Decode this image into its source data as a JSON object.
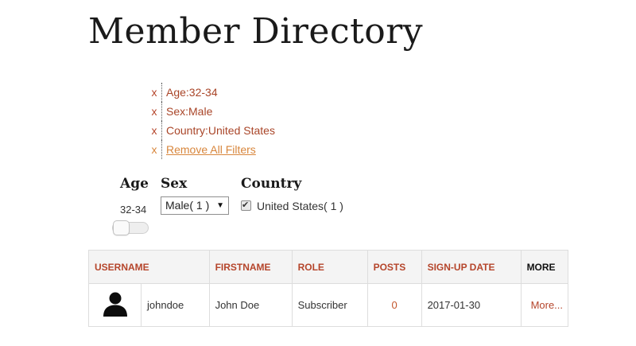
{
  "page": {
    "title": "Member Directory"
  },
  "active_filters": [
    {
      "remove_icon": "x",
      "label": "Age:32-34"
    },
    {
      "remove_icon": "x",
      "label": "Sex:Male"
    },
    {
      "remove_icon": "x",
      "label": "Country:United States"
    }
  ],
  "remove_all": {
    "remove_icon": "x",
    "label": "Remove All Filters"
  },
  "facets": {
    "age": {
      "heading": "Age",
      "value": "32-34"
    },
    "sex": {
      "heading": "Sex",
      "selected": "Male( 1 )",
      "arrow": "▼"
    },
    "country": {
      "heading": "Country",
      "option": "United States( 1 )",
      "checked": true,
      "check_glyph": "✔"
    }
  },
  "table": {
    "columns": [
      "USERNAME",
      "FIRSTNAME",
      "ROLE",
      "POSTS",
      "SIGN-UP DATE",
      "MORE"
    ],
    "rows": [
      {
        "avatar": "user-silhouette-icon",
        "username": "johndoe",
        "firstname": "John Doe",
        "role": "Subscriber",
        "posts": "0",
        "signup_date": "2017-01-30",
        "more": "More..."
      }
    ]
  },
  "colors": {
    "accent": "#b5452b",
    "link": "#d8863c",
    "header_bg": "#f4f4f4",
    "border": "#dddddd"
  }
}
